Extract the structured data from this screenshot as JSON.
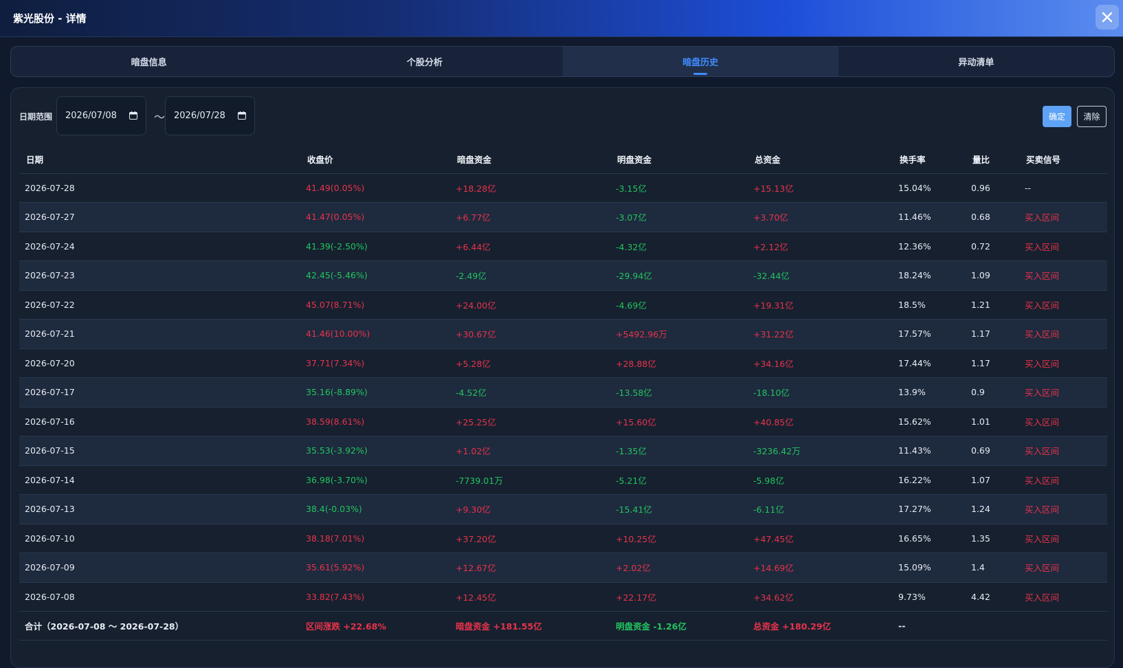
{
  "window": {
    "title": "紫光股份 - 详情"
  },
  "tabs": [
    {
      "label": "暗盘信息",
      "active": false
    },
    {
      "label": "个股分析",
      "active": false
    },
    {
      "label": "暗盘历史",
      "active": true
    },
    {
      "label": "异动清单",
      "active": false
    }
  ],
  "filter": {
    "label": "日期范围",
    "start": "2026/07/08",
    "end": "2026/07/28",
    "separator": "～",
    "confirm_label": "确定",
    "clear_label": "清除"
  },
  "colors": {
    "up": "#e8334a",
    "down": "#22c55e",
    "accent": "#3f8cff"
  },
  "table": {
    "columns": [
      "日期",
      "收盘价",
      "暗盘资金",
      "明盘资金",
      "总资金",
      "换手率",
      "量比",
      "买卖信号"
    ],
    "rows": [
      {
        "date": "2026-07-28",
        "close": "41.49(0.05%)",
        "close_dir": "up",
        "dark": "+18.28亿",
        "dark_dir": "up",
        "lit": "-3.15亿",
        "lit_dir": "down",
        "total": "+15.13亿",
        "total_dir": "up",
        "turnover": "15.04%",
        "vol_ratio": "0.96",
        "signal": "--",
        "signal_dir": "neutral"
      },
      {
        "date": "2026-07-27",
        "close": "41.47(0.05%)",
        "close_dir": "up",
        "dark": "+6.77亿",
        "dark_dir": "up",
        "lit": "-3.07亿",
        "lit_dir": "down",
        "total": "+3.70亿",
        "total_dir": "up",
        "turnover": "11.46%",
        "vol_ratio": "0.68",
        "signal": "买入区间",
        "signal_dir": "up"
      },
      {
        "date": "2026-07-24",
        "close": "41.39(-2.50%)",
        "close_dir": "down",
        "dark": "+6.44亿",
        "dark_dir": "up",
        "lit": "-4.32亿",
        "lit_dir": "down",
        "total": "+2.12亿",
        "total_dir": "up",
        "turnover": "12.36%",
        "vol_ratio": "0.72",
        "signal": "买入区间",
        "signal_dir": "up"
      },
      {
        "date": "2026-07-23",
        "close": "42.45(-5.46%)",
        "close_dir": "down",
        "dark": "-2.49亿",
        "dark_dir": "down",
        "lit": "-29.94亿",
        "lit_dir": "down",
        "total": "-32.44亿",
        "total_dir": "down",
        "turnover": "18.24%",
        "vol_ratio": "1.09",
        "signal": "买入区间",
        "signal_dir": "up"
      },
      {
        "date": "2026-07-22",
        "close": "45.07(8.71%)",
        "close_dir": "up",
        "dark": "+24.00亿",
        "dark_dir": "up",
        "lit": "-4.69亿",
        "lit_dir": "down",
        "total": "+19.31亿",
        "total_dir": "up",
        "turnover": "18.5%",
        "vol_ratio": "1.21",
        "signal": "买入区间",
        "signal_dir": "up"
      },
      {
        "date": "2026-07-21",
        "close": "41.46(10.00%)",
        "close_dir": "up",
        "dark": "+30.67亿",
        "dark_dir": "up",
        "lit": "+5492.96万",
        "lit_dir": "up",
        "total": "+31.22亿",
        "total_dir": "up",
        "turnover": "17.57%",
        "vol_ratio": "1.17",
        "signal": "买入区间",
        "signal_dir": "up"
      },
      {
        "date": "2026-07-20",
        "close": "37.71(7.34%)",
        "close_dir": "up",
        "dark": "+5.28亿",
        "dark_dir": "up",
        "lit": "+28.88亿",
        "lit_dir": "up",
        "total": "+34.16亿",
        "total_dir": "up",
        "turnover": "17.44%",
        "vol_ratio": "1.17",
        "signal": "买入区间",
        "signal_dir": "up"
      },
      {
        "date": "2026-07-17",
        "close": "35.16(-8.89%)",
        "close_dir": "down",
        "dark": "-4.52亿",
        "dark_dir": "down",
        "lit": "-13.58亿",
        "lit_dir": "down",
        "total": "-18.10亿",
        "total_dir": "down",
        "turnover": "13.9%",
        "vol_ratio": "0.9",
        "signal": "买入区间",
        "signal_dir": "up"
      },
      {
        "date": "2026-07-16",
        "close": "38.59(8.61%)",
        "close_dir": "up",
        "dark": "+25.25亿",
        "dark_dir": "up",
        "lit": "+15.60亿",
        "lit_dir": "up",
        "total": "+40.85亿",
        "total_dir": "up",
        "turnover": "15.62%",
        "vol_ratio": "1.01",
        "signal": "买入区间",
        "signal_dir": "up"
      },
      {
        "date": "2026-07-15",
        "close": "35.53(-3.92%)",
        "close_dir": "down",
        "dark": "+1.02亿",
        "dark_dir": "up",
        "lit": "-1.35亿",
        "lit_dir": "down",
        "total": "-3236.42万",
        "total_dir": "down",
        "turnover": "11.43%",
        "vol_ratio": "0.69",
        "signal": "买入区间",
        "signal_dir": "up"
      },
      {
        "date": "2026-07-14",
        "close": "36.98(-3.70%)",
        "close_dir": "down",
        "dark": "-7739.01万",
        "dark_dir": "down",
        "lit": "-5.21亿",
        "lit_dir": "down",
        "total": "-5.98亿",
        "total_dir": "down",
        "turnover": "16.22%",
        "vol_ratio": "1.07",
        "signal": "买入区间",
        "signal_dir": "up"
      },
      {
        "date": "2026-07-13",
        "close": "38.4(-0.03%)",
        "close_dir": "down",
        "dark": "+9.30亿",
        "dark_dir": "up",
        "lit": "-15.41亿",
        "lit_dir": "down",
        "total": "-6.11亿",
        "total_dir": "down",
        "turnover": "17.27%",
        "vol_ratio": "1.24",
        "signal": "买入区间",
        "signal_dir": "up"
      },
      {
        "date": "2026-07-10",
        "close": "38.18(7.01%)",
        "close_dir": "up",
        "dark": "+37.20亿",
        "dark_dir": "up",
        "lit": "+10.25亿",
        "lit_dir": "up",
        "total": "+47.45亿",
        "total_dir": "up",
        "turnover": "16.65%",
        "vol_ratio": "1.35",
        "signal": "买入区间",
        "signal_dir": "up"
      },
      {
        "date": "2026-07-09",
        "close": "35.61(5.92%)",
        "close_dir": "up",
        "dark": "+12.67亿",
        "dark_dir": "up",
        "lit": "+2.02亿",
        "lit_dir": "up",
        "total": "+14.69亿",
        "total_dir": "up",
        "turnover": "15.09%",
        "vol_ratio": "1.4",
        "signal": "买入区间",
        "signal_dir": "up"
      },
      {
        "date": "2026-07-08",
        "close": "33.82(7.43%)",
        "close_dir": "up",
        "dark": "+12.45亿",
        "dark_dir": "up",
        "lit": "+22.17亿",
        "lit_dir": "up",
        "total": "+34.62亿",
        "total_dir": "up",
        "turnover": "9.73%",
        "vol_ratio": "4.42",
        "signal": "买入区间",
        "signal_dir": "up"
      }
    ],
    "summary": {
      "label": "合计（2026-07-08 ～ 2026-07-28）",
      "change": "区间涨跌 +22.68%",
      "dark": "暗盘资金 +181.55亿",
      "lit": "明盘资金 -1.26亿",
      "total": "总资金 +180.29亿",
      "turnover": "--"
    }
  }
}
